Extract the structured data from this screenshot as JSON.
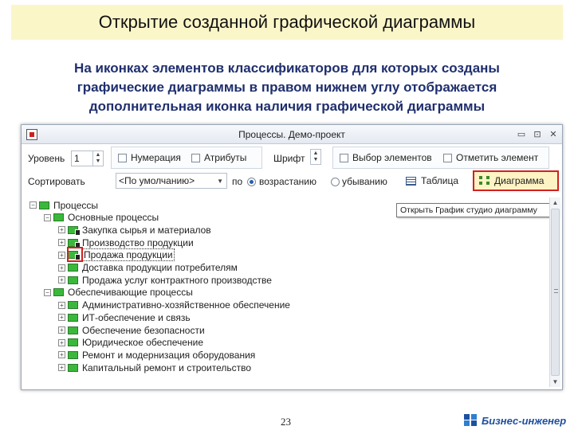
{
  "slide": {
    "title": "Открытие созданной графической диаграммы",
    "subtitle_lines": [
      "На иконках элементов классификаторов для которых созданы",
      "графические диаграммы в правом нижнем углу отображается",
      "дополнительная иконка наличия  графической диаграммы"
    ],
    "page_number": "23",
    "brand": "Бизнес-инженер"
  },
  "window": {
    "title": "Процессы. Демо-проект",
    "controls": {
      "minimize": "▭",
      "maximize": "⊡",
      "close": "✕"
    }
  },
  "toolbar": {
    "level_label": "Уровень",
    "level_value": "1",
    "numbering_label": "Нумерация",
    "attributes_label": "Атрибуты",
    "font_label": "Шрифт",
    "select_elements_label": "Выбор элементов",
    "mark_element_label": "Отметить элемент",
    "sort_label": "Сортировать",
    "sort_value": "<По умолчанию>",
    "sort_by_label": "по",
    "ascending_label": "возрастанию",
    "descending_label": "убыванию",
    "sort_order": "ascending",
    "table_label": "Таблица",
    "diagram_label": "Диаграмма",
    "diagram_tooltip": "Открыть График студио диаграмму"
  },
  "tree": {
    "rows": [
      {
        "label": "Процессы",
        "level": 0,
        "expander": "−",
        "diagram": false
      },
      {
        "label": "Основные процессы",
        "level": 1,
        "expander": "−",
        "diagram": false
      },
      {
        "label": "Закупка сырья и материалов",
        "level": 2,
        "expander": "+",
        "diagram": true
      },
      {
        "label": "Производство продукции",
        "level": 2,
        "expander": "+",
        "diagram": true
      },
      {
        "label": "Продажа продукции",
        "level": 2,
        "expander": "+",
        "diagram": true,
        "selected": true,
        "highlighted": true
      },
      {
        "label": "Доставка продукции потребителям",
        "level": 2,
        "expander": "+",
        "diagram": false
      },
      {
        "label": "Продажа услуг контрактного производстве",
        "level": 2,
        "expander": "+",
        "diagram": false
      },
      {
        "label": "Обеспечивающие процессы",
        "level": 1,
        "expander": "−",
        "diagram": false
      },
      {
        "label": "Административно-хозяйственное обеспечение",
        "level": 2,
        "expander": "+",
        "diagram": false
      },
      {
        "label": "ИТ-обеспечение и связь",
        "level": 2,
        "expander": "+",
        "diagram": false
      },
      {
        "label": "Обеспечение безопасности",
        "level": 2,
        "expander": "+",
        "diagram": false
      },
      {
        "label": "Юридическое обеспечение",
        "level": 2,
        "expander": "+",
        "diagram": false
      },
      {
        "label": "Ремонт и модернизация оборудования",
        "level": 2,
        "expander": "+",
        "diagram": false
      },
      {
        "label": "Капитальный ремонт и строительство",
        "level": 2,
        "expander": "+",
        "diagram": false
      }
    ]
  },
  "colors": {
    "title_bg": "#fbf6c8",
    "subtitle_text": "#1f2f6e",
    "highlight_red": "#d42020",
    "node_green": "#3bb83b",
    "brand_blue": "#1f4fa0"
  },
  "icons": {
    "tree_node": "green-node-icon",
    "diagram_badge": "diagram-badge-icon",
    "table": "table-icon",
    "diagram": "diagram-icon",
    "app": "app-icon",
    "brand": "brand-logo-icon"
  }
}
